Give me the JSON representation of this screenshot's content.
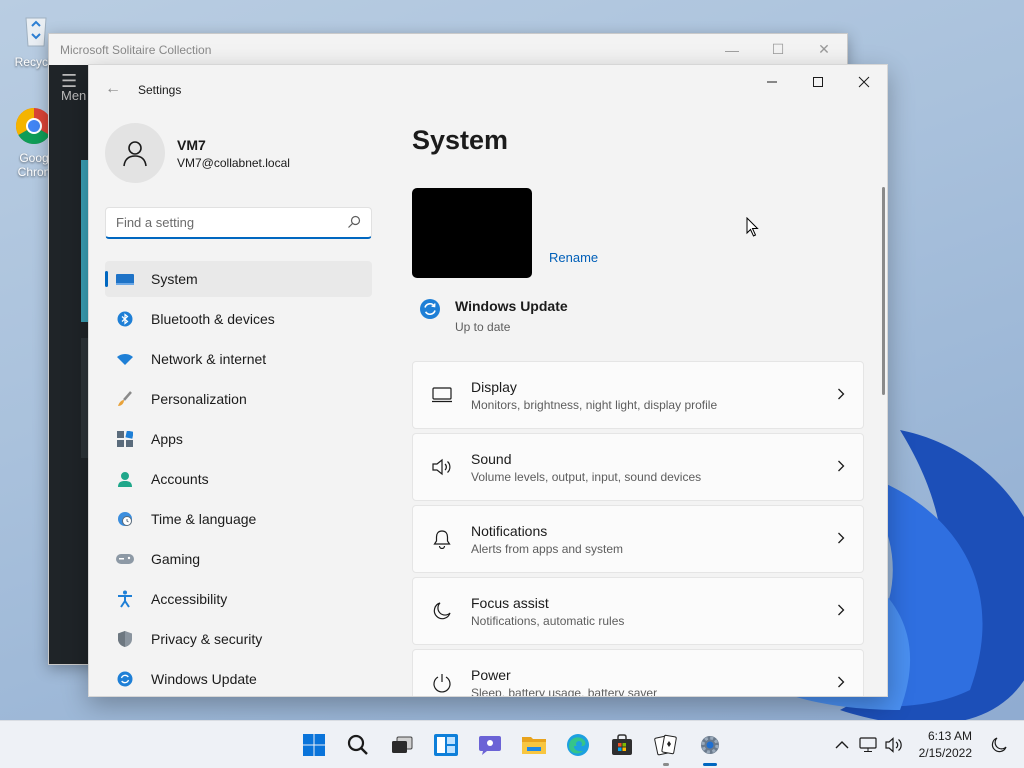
{
  "desktop": {
    "icons": [
      {
        "label": "Recycle"
      },
      {
        "label": "Goog Chron"
      }
    ]
  },
  "solitaire": {
    "title": "Microsoft Solitaire Collection",
    "menu_label": "Men"
  },
  "settings": {
    "app_title": "Settings",
    "profile": {
      "name": "VM7",
      "email": "VM7@collabnet.local"
    },
    "search": {
      "placeholder": "Find a setting"
    },
    "nav": [
      {
        "label": "System",
        "icon": "system-icon",
        "active": true
      },
      {
        "label": "Bluetooth & devices",
        "icon": "bluetooth-icon"
      },
      {
        "label": "Network & internet",
        "icon": "wifi-icon"
      },
      {
        "label": "Personalization",
        "icon": "brush-icon"
      },
      {
        "label": "Apps",
        "icon": "apps-icon"
      },
      {
        "label": "Accounts",
        "icon": "accounts-icon"
      },
      {
        "label": "Time & language",
        "icon": "globe-clock-icon"
      },
      {
        "label": "Gaming",
        "icon": "gamepad-icon"
      },
      {
        "label": "Accessibility",
        "icon": "accessibility-icon"
      },
      {
        "label": "Privacy & security",
        "icon": "shield-icon"
      },
      {
        "label": "Windows Update",
        "icon": "update-icon"
      }
    ],
    "main": {
      "title": "System",
      "rename": "Rename",
      "windows_update": {
        "title": "Windows Update",
        "status": "Up to date"
      },
      "cards": [
        {
          "title": "Display",
          "subtitle": "Monitors, brightness, night light, display profile",
          "icon": "monitor-icon"
        },
        {
          "title": "Sound",
          "subtitle": "Volume levels, output, input, sound devices",
          "icon": "speaker-icon"
        },
        {
          "title": "Notifications",
          "subtitle": "Alerts from apps and system",
          "icon": "bell-icon"
        },
        {
          "title": "Focus assist",
          "subtitle": "Notifications, automatic rules",
          "icon": "moon-icon"
        },
        {
          "title": "Power",
          "subtitle": "Sleep, battery usage, battery saver",
          "icon": "power-icon"
        }
      ]
    }
  },
  "taskbar": {
    "apps": [
      "start-icon",
      "search-icon",
      "task-view-icon",
      "widgets-icon",
      "chat-icon",
      "file-explorer-icon",
      "edge-icon",
      "store-icon",
      "solitaire-icon",
      "settings-icon"
    ],
    "clock": {
      "time": "6:13 AM",
      "date": "2/15/2022"
    }
  },
  "colors": {
    "accent": "#0067c0",
    "link": "#005fb8",
    "window_bg": "#f3f3f3"
  }
}
